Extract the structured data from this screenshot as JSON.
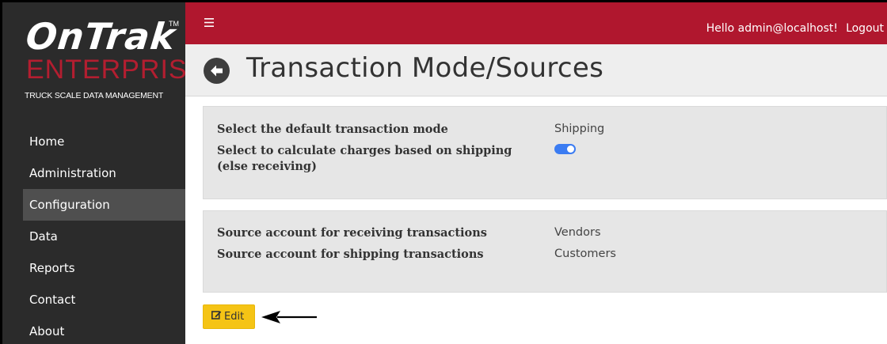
{
  "brand": {
    "logo_main": "OnTrak",
    "logo_tm": "TM",
    "logo_sub": "ENTERPRISE",
    "tagline": "TRUCK SCALE DATA MANAGEMENT"
  },
  "topbar": {
    "menu_icon": "hamburger-icon",
    "greeting": "Hello admin@localhost!",
    "logout_label": "Logout"
  },
  "sidebar": {
    "items": [
      {
        "label": "Home",
        "active": false
      },
      {
        "label": "Administration",
        "active": false
      },
      {
        "label": "Configuration",
        "active": true
      },
      {
        "label": "Data",
        "active": false
      },
      {
        "label": "Reports",
        "active": false
      },
      {
        "label": "Contact",
        "active": false
      },
      {
        "label": "About",
        "active": false
      }
    ]
  },
  "page": {
    "back_icon": "arrow-left-circle-icon",
    "title": "Transaction Mode/Sources"
  },
  "mode_panel": {
    "default_mode_label": "Select the default transaction mode",
    "default_mode_value": "Shipping",
    "calc_label": "Select to calculate charges based on shipping (else receiving)",
    "calc_toggle_on": true
  },
  "sources_panel": {
    "receiving_label": "Source account for receiving transactions",
    "receiving_value": "Vendors",
    "shipping_label": "Source account for shipping transactions",
    "shipping_value": "Customers"
  },
  "actions": {
    "edit_label": "Edit",
    "edit_icon": "edit-icon"
  },
  "colors": {
    "brand_red": "#b0172e",
    "sidebar_bg": "#2b2b2b",
    "edit_yellow": "#f5c415",
    "toggle_blue": "#3b7cf2"
  }
}
